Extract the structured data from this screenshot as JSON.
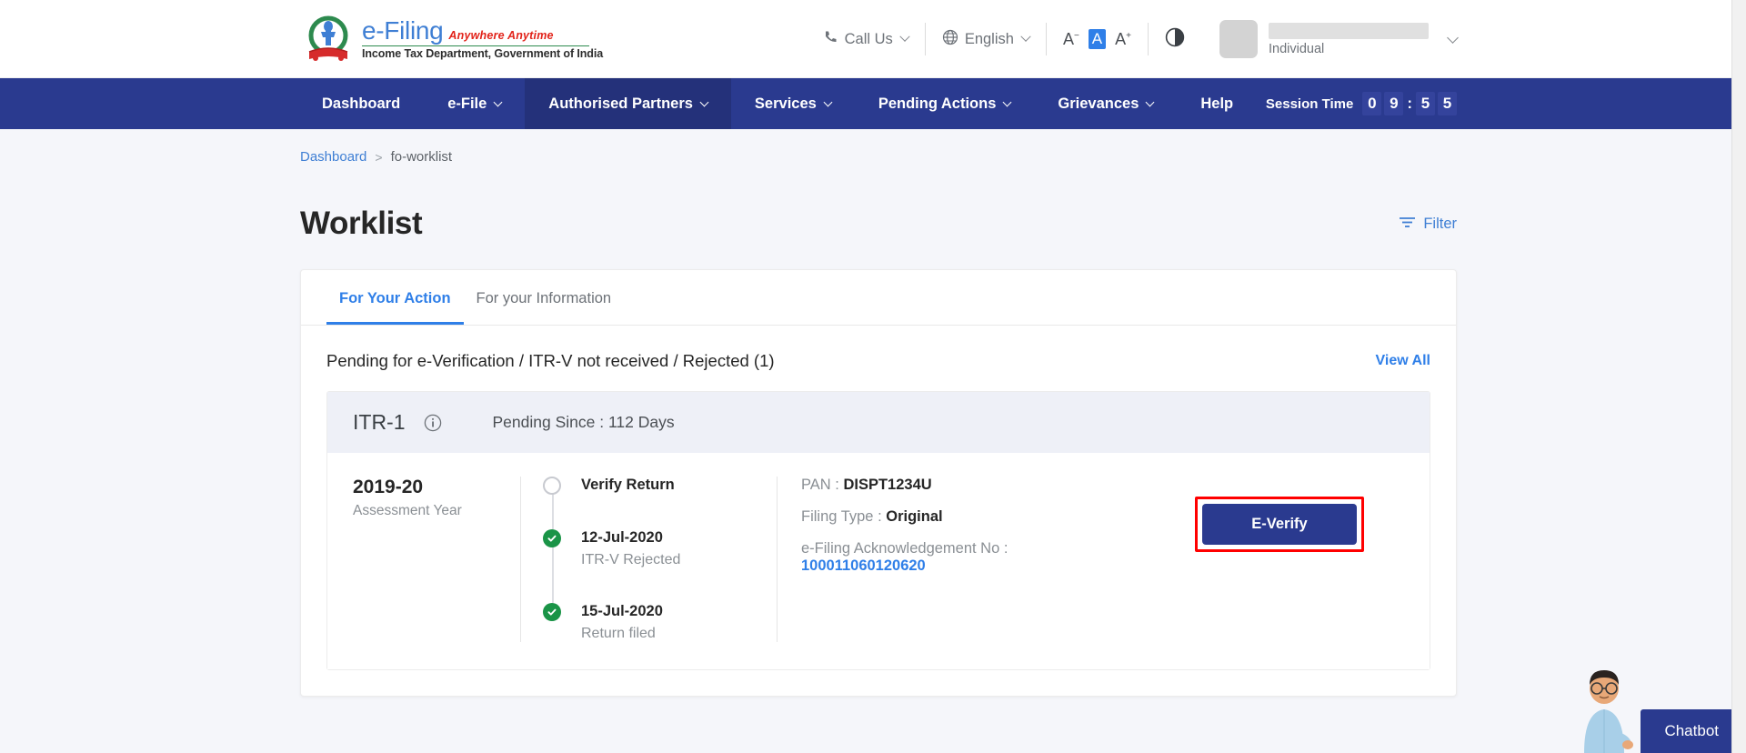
{
  "header": {
    "logo": {
      "brand": "e-Filing",
      "tagline": "Anywhere Anytime",
      "department": "Income Tax Department, Government of India",
      "emblem_icon": "india-national-emblem-icon"
    },
    "call_us": "Call Us",
    "language": "English",
    "font_decrease": "A",
    "font_normal": "A",
    "font_increase": "A",
    "contrast_icon": "contrast-icon",
    "user": {
      "name": "",
      "role": "Individual"
    }
  },
  "nav": {
    "items": [
      {
        "label": "Dashboard",
        "has_caret": false,
        "active": false
      },
      {
        "label": "e-File",
        "has_caret": true,
        "active": false
      },
      {
        "label": "Authorised Partners",
        "has_caret": true,
        "active": true
      },
      {
        "label": "Services",
        "has_caret": true,
        "active": false
      },
      {
        "label": "Pending Actions",
        "has_caret": true,
        "active": false
      },
      {
        "label": "Grievances",
        "has_caret": true,
        "active": false
      },
      {
        "label": "Help",
        "has_caret": false,
        "active": false
      }
    ],
    "session_label": "Session Time",
    "session_digits": [
      "0",
      "9",
      "5",
      "5"
    ],
    "session_colon": ":"
  },
  "breadcrumb": {
    "root": "Dashboard",
    "separator": ">",
    "current": "fo-worklist"
  },
  "page": {
    "title": "Worklist",
    "filter_label": "Filter",
    "filter_icon": "filter-icon"
  },
  "tabs": [
    {
      "label": "For Your Action",
      "active": true
    },
    {
      "label": "For your Information",
      "active": false
    }
  ],
  "section": {
    "title": "Pending for e-Verification / ITR-V not received / Rejected (1)",
    "view_all": "View All"
  },
  "item": {
    "itr_name": "ITR-1",
    "info_icon": "info-icon",
    "pending_since": "Pending Since : 112 Days",
    "assessment_year_value": "2019-20",
    "assessment_year_label": "Assessment Year",
    "timeline": [
      {
        "status": "pending",
        "title": "Verify Return",
        "subtitle": ""
      },
      {
        "status": "done",
        "title": "12-Jul-2020",
        "subtitle": "ITR-V Rejected"
      },
      {
        "status": "done",
        "title": "15-Jul-2020",
        "subtitle": "Return filed"
      }
    ],
    "details": {
      "pan_label": "PAN :",
      "pan_value": "DISPT1234U",
      "filing_type_label": "Filing Type :",
      "filing_type_value": "Original",
      "ack_label": "e-Filing Acknowledgement No :",
      "ack_value": "100011060120620"
    },
    "action_button": "E-Verify"
  },
  "chatbot": {
    "label": "Chatbot",
    "avatar_icon": "chatbot-avatar-icon"
  },
  "colors": {
    "nav_blue": "#2a3a8f",
    "link_blue": "#2f7fe8",
    "success_green": "#1a9447",
    "highlight_red": "#ff0000",
    "page_bg": "#f5f6fa"
  }
}
